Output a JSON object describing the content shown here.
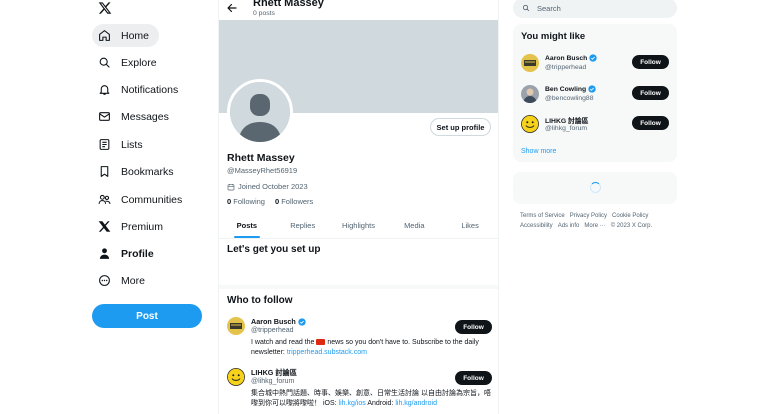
{
  "nav": {
    "items": [
      {
        "label": "Home",
        "icon": "home-icon"
      },
      {
        "label": "Explore",
        "icon": "search-icon"
      },
      {
        "label": "Notifications",
        "icon": "bell-icon"
      },
      {
        "label": "Messages",
        "icon": "envelope-icon"
      },
      {
        "label": "Lists",
        "icon": "list-icon"
      },
      {
        "label": "Bookmarks",
        "icon": "bookmark-icon"
      },
      {
        "label": "Communities",
        "icon": "people-icon"
      },
      {
        "label": "Premium",
        "icon": "x-icon"
      },
      {
        "label": "Profile",
        "icon": "person-icon"
      },
      {
        "label": "More",
        "icon": "more-circle-icon"
      }
    ],
    "post_label": "Post"
  },
  "header": {
    "name": "Rhett Massey",
    "posts_count": "0 posts"
  },
  "profile": {
    "setup_button": "Set up profile",
    "name": "Rhett Massey",
    "handle": "@MasseyRhet56919",
    "joined": "Joined October 2023",
    "following_count": "0",
    "following_label": "Following",
    "followers_count": "0",
    "followers_label": "Followers"
  },
  "tabs": [
    "Posts",
    "Replies",
    "Highlights",
    "Media",
    "Likes"
  ],
  "setup_title": "Let's get you set up",
  "who_to_follow": {
    "title": "Who to follow",
    "items": [
      {
        "name": "Aaron Busch",
        "handle": "@tripperhead",
        "follow": "Follow",
        "bio_pre": "I watch and read the",
        "bio_post": "news so you don't have to. Subscribe to the daily newsletter:",
        "bio_link": "tripperhead.substack.com"
      },
      {
        "name": "LIHKG 討論區",
        "handle": "@lihkg_forum",
        "follow": "Follow",
        "bio_pre": "集合城中熱門話題、時事、娛樂、創意、日常生活討論 以自由討論為宗旨，唔嚟到你可以嚟將嚟啦！ iOS:",
        "bio_link": "lih.kg/ios",
        "bio_mid": "Android:",
        "bio_link2": "lih.kg/android"
      }
    ]
  },
  "search": {
    "placeholder": "Search"
  },
  "you_might_like": {
    "title": "You might like",
    "items": [
      {
        "name": "Aaron Busch",
        "handle": "@tripperhead",
        "follow": "Follow"
      },
      {
        "name": "Ben Cowling",
        "handle": "@bencowling88",
        "follow": "Follow"
      },
      {
        "name": "LIHKG 討論區",
        "handle": "@lihkg_forum",
        "follow": "Follow"
      }
    ],
    "show_more": "Show more"
  },
  "footer": {
    "links": [
      "Terms of Service",
      "Privacy Policy",
      "Cookie Policy",
      "Accessibility",
      "Ads info",
      "More ···",
      "© 2023 X Corp."
    ]
  },
  "colors": {
    "accent": "#1d9bf0",
    "text": "#0f1419",
    "muted": "#536471"
  }
}
